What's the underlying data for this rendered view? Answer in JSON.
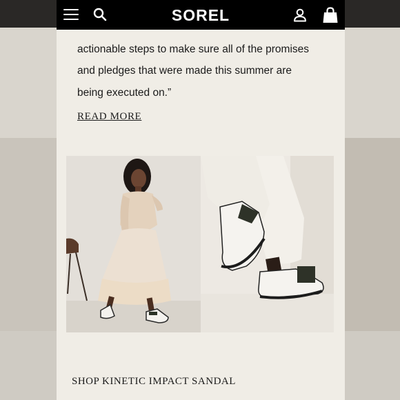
{
  "header": {
    "brand": "SOREL",
    "menu_icon": "hamburger-menu-icon",
    "search_icon": "search-icon",
    "account_icon": "user-account-icon",
    "bag_icon": "shopping-bag-icon"
  },
  "article": {
    "quote_lines": [
      "actionable steps to make sure all of the promises",
      "and pledges that were made this summer are",
      "being executed on.”"
    ],
    "read_more": "READ MORE"
  },
  "images": {
    "left_alt": "woman in beige dress wearing sandals",
    "right_alt": "close-up of white platform sandals"
  },
  "shop": {
    "label": "SHOP KINETIC IMPACT SANDAL"
  },
  "colors": {
    "header_bg": "#000000",
    "page_bg": "#f0ede6",
    "text": "#1b1b1b"
  }
}
